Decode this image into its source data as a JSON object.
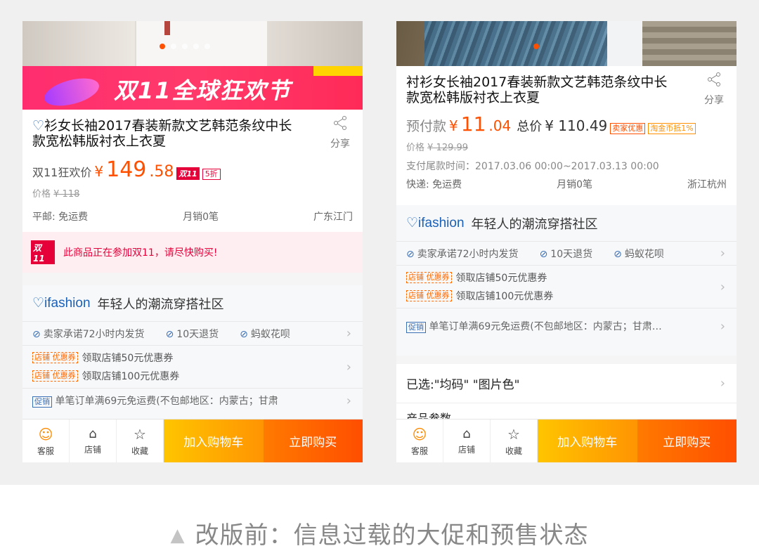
{
  "left": {
    "banner_text": "双11全球狂欢节",
    "title": "衫女长袖2017春装新款文艺韩范条纹中长款宽松韩版衬衣上衣夏",
    "share_label": "分享",
    "price_prefix": "双11狂欢价",
    "currency": "¥",
    "price_int": "149",
    "price_dec": ".58",
    "badge_d11": "双11",
    "badge_discount": "5折",
    "orig_price_label": "价格",
    "orig_price": "¥ 118",
    "shipping": "平邮: 免运费",
    "monthly_sales": "月销0笔",
    "location": "广东江门",
    "promo_badge": "双11",
    "promo_text": "此商品正在参加双11，请尽快购买!",
    "ifashion_logo": "ifashion",
    "ifashion_slogan": "年轻人的潮流穿搭社区",
    "services": [
      "卖家承诺72小时内发货",
      "10天退货",
      "蚂蚁花呗"
    ],
    "coupon_tag": "店铺 优惠券",
    "coupons": [
      "领取店铺50元优惠券",
      "领取店铺100元优惠券"
    ],
    "promo_tag": "促销",
    "promo_line": "单笔订单满69元免运费(不包邮地区：内蒙古；甘肃"
  },
  "right": {
    "title": "衬衫女长袖2017春装新款文艺韩范条纹中长款宽松韩版衬衣上衣夏",
    "share_label": "分享",
    "prepay_label": "预付款",
    "currency": "¥",
    "prepay_int": "11",
    "prepay_dec": ".04",
    "total_label": "总价",
    "total_value": "¥ 110.49",
    "tag_seller": "卖家优惠",
    "tag_coin": "淘金币抵1%",
    "orig_price_label": "价格",
    "orig_price": "¥ 129.99",
    "final_pay_time": "支付尾款时间：2017.03.06 00:00~2017.03.13 00:00",
    "shipping": "快递: 免运费",
    "monthly_sales": "月销0笔",
    "location": "浙江杭州",
    "ifashion_logo": "ifashion",
    "ifashion_slogan": "年轻人的潮流穿搭社区",
    "services": [
      "卖家承诺72小时内发货",
      "10天退货",
      "蚂蚁花呗"
    ],
    "coupon_tag": "店铺 优惠券",
    "coupons": [
      "领取店铺50元优惠券",
      "领取店铺100元优惠券"
    ],
    "promo_tag": "促销",
    "promo_line": "单笔订单满69元免运费(不包邮地区：内蒙古；甘肃…",
    "selected": "已选:\"均码\" \"图片色\"",
    "partial_text": "产品参数"
  },
  "bottom_bar": {
    "service": "客服",
    "shop": "店铺",
    "favorite": "收藏",
    "add_cart": "加入购物车",
    "buy_now": "立即购买"
  },
  "caption": "改版前：信息过载的大促和预售状态",
  "colors": {
    "price_orange": "#ff5000",
    "double11_red": "#e6003a",
    "ifashion_blue": "#1b61b7",
    "cart_yellow": "#ffb400",
    "buy_orange": "#ff5a00"
  }
}
